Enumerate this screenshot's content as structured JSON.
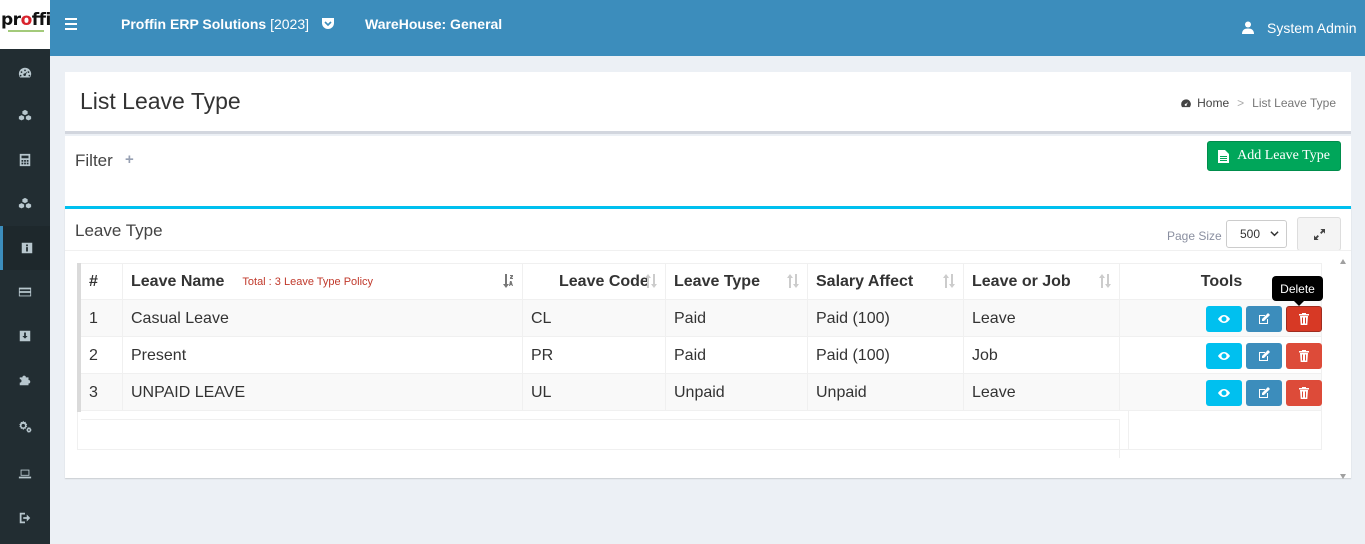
{
  "brand": {
    "logo_text_a": "pr",
    "logo_text_o": "o",
    "logo_text_b": "ffin"
  },
  "header": {
    "app_name": "Proffin ERP Solutions",
    "app_year": "[2023]",
    "warehouse": "WareHouse: General",
    "user": "System Admin"
  },
  "sidebar": {
    "items": [
      {
        "icon": "dashboard-icon"
      },
      {
        "icon": "cubes-icon"
      },
      {
        "icon": "calculator-icon"
      },
      {
        "icon": "cubes-icon"
      },
      {
        "icon": "info-icon",
        "active": true
      },
      {
        "icon": "credit-card-icon"
      },
      {
        "icon": "download-icon"
      },
      {
        "icon": "puzzle-icon"
      },
      {
        "icon": "cogs-icon"
      },
      {
        "icon": "laptop-icon"
      },
      {
        "icon": "sign-out-icon"
      }
    ]
  },
  "page": {
    "title": "List Leave Type",
    "breadcrumb_home": "Home",
    "breadcrumb_sep": ">",
    "breadcrumb_current": "List Leave Type"
  },
  "filter": {
    "title": "Filter",
    "toggle": "+",
    "add_button": "Add Leave Type"
  },
  "list": {
    "title": "Leave Type",
    "page_size_label": "Page Size",
    "page_size": "500",
    "columns": {
      "num": "#",
      "name": "Leave Name",
      "total": "Total : 3 Leave Type Policy",
      "code": "Leave Code",
      "type": "Leave Type",
      "salary": "Salary Affect",
      "leave_or_job": "Leave or Job",
      "tools": "Tools"
    },
    "rows": [
      {
        "num": "1",
        "name": "Casual Leave",
        "code": "CL",
        "type": "Paid",
        "salary": "Paid (100)",
        "leave_or_job": "Leave"
      },
      {
        "num": "2",
        "name": "Present",
        "code": "PR",
        "type": "Paid",
        "salary": "Paid (100)",
        "leave_or_job": "Job"
      },
      {
        "num": "3",
        "name": "UNPAID LEAVE",
        "code": "UL",
        "type": "Unpaid",
        "salary": "Unpaid",
        "leave_or_job": "Leave"
      }
    ],
    "tooltip": "Delete"
  },
  "colors": {
    "header": "#3c8dbc",
    "sidebar": "#222d32",
    "success": "#00a65a",
    "info": "#00c0ef",
    "danger": "#dd4b39"
  }
}
